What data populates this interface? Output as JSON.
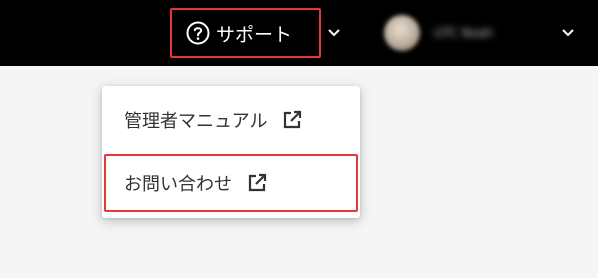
{
  "header": {
    "support_label": "サポート",
    "user_name": "UTC Noah"
  },
  "support_menu": {
    "items": [
      {
        "label": "管理者マニュアル",
        "icon": "external-link-icon"
      },
      {
        "label": "お問い合わせ",
        "icon": "external-link-icon"
      }
    ]
  },
  "colors": {
    "header_bg": "#000000",
    "highlight_border": "#e53935",
    "page_bg": "#f5f5f5",
    "menu_text": "#333333"
  }
}
